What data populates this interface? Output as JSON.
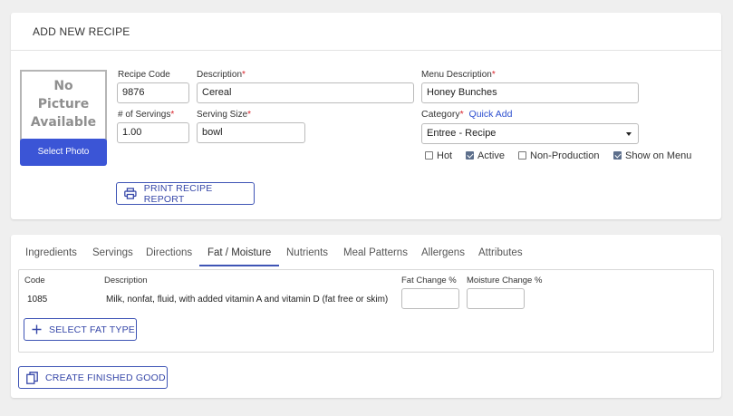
{
  "header": {
    "title": "ADD NEW RECIPE"
  },
  "photo": {
    "placeholder_line1": "No",
    "placeholder_line2": "Picture",
    "placeholder_line3": "Available",
    "select_label": "Select Photo"
  },
  "form": {
    "recipe_code": {
      "label": "Recipe Code",
      "value": "9876"
    },
    "description": {
      "label": "Description",
      "value": "Cereal"
    },
    "menu_description": {
      "label": "Menu Description",
      "value": "Honey Bunches"
    },
    "servings": {
      "label": "# of Servings",
      "value": "1.00"
    },
    "serving_size": {
      "label": "Serving Size",
      "value": "bowl"
    },
    "category": {
      "label": "Category",
      "quick_add": "Quick Add",
      "value": "Entree - Recipe"
    },
    "required_mark": "*"
  },
  "flags": [
    {
      "label": "Hot",
      "checked": false
    },
    {
      "label": "Active",
      "checked": true
    },
    {
      "label": "Non-Production",
      "checked": false
    },
    {
      "label": "Show on Menu",
      "checked": true
    }
  ],
  "buttons": {
    "print_report": "PRINT RECIPE REPORT",
    "select_fat_type": "SELECT FAT TYPE",
    "create_finished_good": "CREATE FINISHED GOOD"
  },
  "tabs": [
    "Ingredients",
    "Servings",
    "Directions",
    "Fat / Moisture",
    "Nutrients",
    "Meal Patterns",
    "Allergens",
    "Attributes"
  ],
  "active_tab": "Fat / Moisture",
  "fat_table": {
    "headers": {
      "code": "Code",
      "description": "Description",
      "fat_change": "Fat Change %",
      "moisture_change": "Moisture Change %"
    },
    "rows": [
      {
        "code": "1085",
        "description": "Milk, nonfat, fluid, with added vitamin A and vitamin D (fat free or skim)",
        "fat_change": "",
        "moisture_change": ""
      }
    ]
  },
  "colors": {
    "primary": "#3b55d6",
    "required": "#d9242c",
    "link": "#2d4fcf"
  }
}
